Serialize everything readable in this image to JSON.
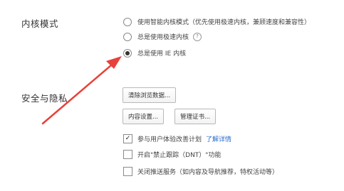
{
  "kernel": {
    "title": "内核模式",
    "options": [
      {
        "label": "使用智能内核模式（优先使用极速内核，兼顾速度和兼容性）",
        "checked": false
      },
      {
        "label": "总是使用极速内核",
        "checked": false,
        "help_glyph": "?"
      },
      {
        "label": "总是使用 IE 内核",
        "checked": true
      }
    ]
  },
  "security": {
    "title": "安全与隐私",
    "clear_data_button": "清除浏览数据...",
    "content_settings_button": "内容设置...",
    "manage_certs_button": "管理证书...",
    "checkboxes": [
      {
        "label": "参与用户体验改善计划",
        "checked": true,
        "link": "了解详情"
      },
      {
        "label": "开启\"禁止跟踪（DNT）\"功能",
        "checked": false
      },
      {
        "label": "关闭推送服务（如内容及导航推荐，特权活动等）",
        "checked": false
      }
    ],
    "check_glyph": "✓"
  },
  "annotation": {
    "arrow_color": "#e8413a"
  }
}
